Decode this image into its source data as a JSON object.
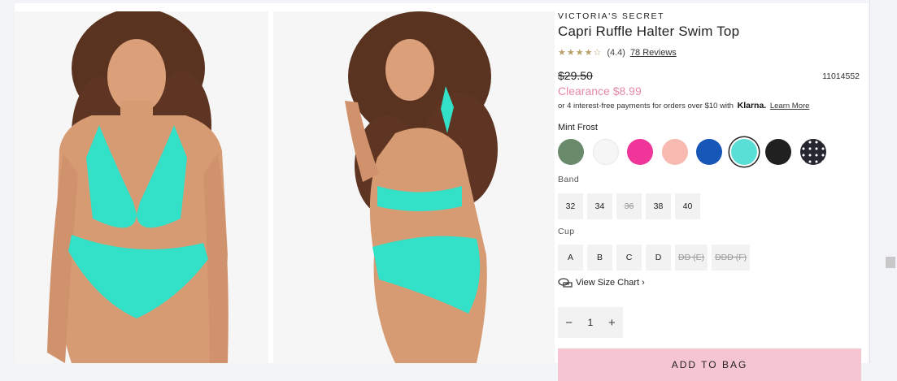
{
  "product": {
    "brand": "VICTORIA'S SECRET",
    "title": "Capri Ruffle Halter Swim Top",
    "rating_stars": "★★★★☆",
    "rating_value": "(4.4)",
    "reviews_label": "78 Reviews",
    "old_price": "$29.50",
    "sku": "11014552",
    "clearance": "Clearance $8.99",
    "klarna_prefix": "or 4 interest-free payments for orders over $10 with",
    "klarna_brand": "Klarna.",
    "klarna_link": "Learn More"
  },
  "colors": {
    "selected_name": "Mint Frost",
    "swatches": [
      {
        "name": "green",
        "hex": "#6a8a6c",
        "selected": false
      },
      {
        "name": "white",
        "hex": "#f6f6f6",
        "selected": false
      },
      {
        "name": "hot-pink",
        "hex": "#f0359a",
        "selected": false
      },
      {
        "name": "peach",
        "hex": "#f7b9b0",
        "selected": false
      },
      {
        "name": "blue",
        "hex": "#1657b7",
        "selected": false
      },
      {
        "name": "mint-frost",
        "hex": "#59dfd6",
        "selected": true
      },
      {
        "name": "black",
        "hex": "#202020",
        "selected": false
      },
      {
        "name": "black-dot",
        "hex": "#262630",
        "selected": false
      }
    ]
  },
  "band": {
    "label": "Band",
    "options": [
      {
        "label": "32",
        "available": true
      },
      {
        "label": "34",
        "available": true
      },
      {
        "label": "36",
        "available": false
      },
      {
        "label": "38",
        "available": true
      },
      {
        "label": "40",
        "available": true
      }
    ]
  },
  "cup": {
    "label": "Cup",
    "options": [
      {
        "label": "A",
        "available": true
      },
      {
        "label": "B",
        "available": true
      },
      {
        "label": "C",
        "available": true
      },
      {
        "label": "D",
        "available": true
      },
      {
        "label": "DD (E)",
        "available": false
      },
      {
        "label": "DDD (F)",
        "available": false
      }
    ]
  },
  "size_chart_label": "View Size Chart ›",
  "quantity": {
    "minus": "−",
    "value": "1",
    "plus": "+"
  },
  "add_to_bag": "ADD TO BAG",
  "theme": {
    "swimsuit": "#33e0c8",
    "clearance": "#e58aa6",
    "bag_button": "#f5c6d2"
  }
}
